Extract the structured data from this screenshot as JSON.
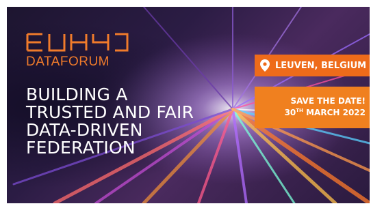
{
  "brand": {
    "logo_text": "EUHYD",
    "subtitle": "DATAFORUM"
  },
  "headline": {
    "lines": [
      "BUILDING A",
      "TRUSTED AND FAIR",
      "DATA-DRIVEN",
      "FEDERATION"
    ]
  },
  "location": {
    "icon": "location-pin-icon",
    "text": "LEUVEN, BELGIUM"
  },
  "event_date": {
    "save_text": "SAVE THE DATE!",
    "day": "30",
    "ordinal": "TH",
    "month_year": "MARCH 2022"
  },
  "colors": {
    "accent_orange": "#f07b2b",
    "badge_orange": "#ee6b1a",
    "background_dark": "#2b1c44",
    "text_white": "#ffffff"
  }
}
